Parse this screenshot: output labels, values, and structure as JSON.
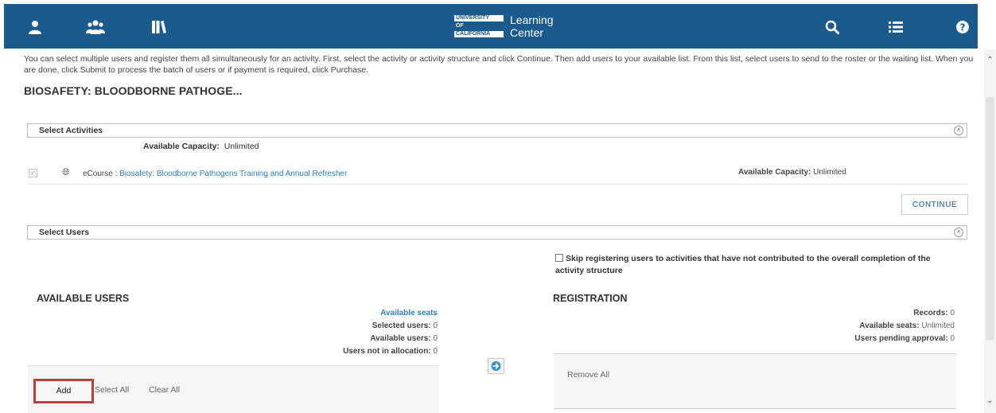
{
  "header": {
    "brand_logo_lines": [
      "UNIVERSITY",
      "OF",
      "CALIFORNIA"
    ],
    "brand_line1": "Learning",
    "brand_line2": "Center",
    "color": "#1b5a8c",
    "icons": [
      "user-icon",
      "users-group-icon",
      "library-icon",
      "search-icon",
      "list-icon",
      "help-icon"
    ]
  },
  "intro_text": "You can select multiple users and register them all simultaneously for an activity. First, select the activity or activity structure and click Continue. Then add users to your available list. From this list, select users to send to the roster or the waiting list. When you are done, click Submit to process the batch of users or if payment is required, click Purchase.",
  "page_title": "BIOSAFETY: BLOODBORNE PATHOGE...",
  "select_activities": {
    "label": "Select Activities",
    "capacity_label": "Available Capacity:",
    "capacity_value": "Unlimited",
    "course": {
      "type": "eCourse : ",
      "name": "Biosafety: Bloodborne Pathogens Training and Annual Refresher",
      "capacity_label": "Available Capacity:",
      "capacity_value": "Unlimited",
      "checked": true
    },
    "continue_label": "CONTINUE"
  },
  "select_users": {
    "label": "Select Users",
    "skip_text": "Skip registering users to activities that have not contributed to the overall completion of the activity structure",
    "available": {
      "heading": "AVAILABLE USERS",
      "seats_link": "Available seats",
      "selected_label": "Selected users:",
      "selected_value": "0",
      "available_label": "Available users:",
      "available_value": "0",
      "not_alloc_label": "Users not in allocation:",
      "not_alloc_value": "0",
      "add_label": "Add",
      "select_all_label": "Select All",
      "clear_all_label": "Clear All"
    },
    "registration": {
      "heading": "REGISTRATION",
      "records_label": "Records:",
      "records_value": "0",
      "seats_label": "Available seats:",
      "seats_value": "Unlimited",
      "pending_label": "Users pending approval:",
      "pending_value": "0",
      "remove_all_label": "Remove All"
    }
  },
  "colors": {
    "header_bg": "#1b5a8c",
    "link": "#2f7fbf",
    "highlight_border": "#b9403b"
  }
}
